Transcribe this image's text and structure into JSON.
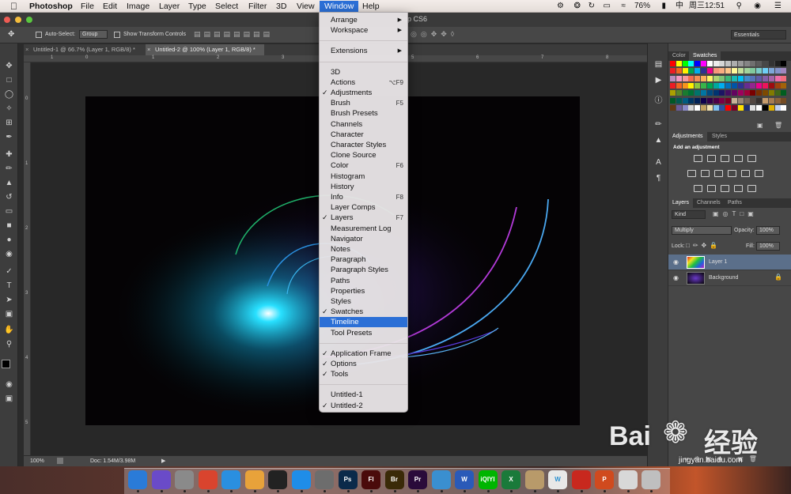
{
  "menubar": {
    "app_name": "Photoshop",
    "items": [
      "File",
      "Edit",
      "Image",
      "Layer",
      "Type",
      "Select",
      "Filter",
      "3D",
      "View",
      "Window",
      "Help"
    ],
    "status": {
      "battery": "76%",
      "clock": "周三12:51"
    }
  },
  "window_title_fragment": "hop CS6",
  "options_bar": {
    "auto_select_label": "Auto-Select:",
    "auto_select_value": "Group",
    "transform_label": "Show Transform Controls",
    "workspace": "Essentials"
  },
  "doc_tabs": [
    {
      "label": "Untitled-1 @ 66.7% (Layer 1, RGB/8) *"
    },
    {
      "label": "Untitled-2 @ 100% (Layer 1, RGB/8) *"
    }
  ],
  "ruler": {
    "h_ticks": [
      "1",
      "0",
      "1",
      "2",
      "3",
      "4",
      "5",
      "6",
      "7",
      "8"
    ],
    "v_ticks": [
      "0",
      "1",
      "2",
      "3",
      "4",
      "5"
    ]
  },
  "statusbar": {
    "zoom": "100%",
    "doc": "Doc: 1.54M/3.98M"
  },
  "window_menu": {
    "items": [
      {
        "label": "Arrange",
        "submenu": true
      },
      {
        "label": "Workspace",
        "submenu": true
      },
      {
        "sep": true
      },
      {
        "label": "Extensions",
        "submenu": true
      },
      {
        "sep": true
      },
      {
        "label": "3D"
      },
      {
        "label": "Actions",
        "shortcut": "⌥F9"
      },
      {
        "label": "Adjustments",
        "checked": true
      },
      {
        "label": "Brush",
        "shortcut": "F5"
      },
      {
        "label": "Brush Presets"
      },
      {
        "label": "Channels"
      },
      {
        "label": "Character"
      },
      {
        "label": "Character Styles"
      },
      {
        "label": "Clone Source"
      },
      {
        "label": "Color",
        "shortcut": "F6"
      },
      {
        "label": "Histogram"
      },
      {
        "label": "History"
      },
      {
        "label": "Info",
        "shortcut": "F8"
      },
      {
        "label": "Layer Comps"
      },
      {
        "label": "Layers",
        "checked": true,
        "shortcut": "F7"
      },
      {
        "label": "Measurement Log"
      },
      {
        "label": "Navigator"
      },
      {
        "label": "Notes"
      },
      {
        "label": "Paragraph"
      },
      {
        "label": "Paragraph Styles"
      },
      {
        "label": "Paths"
      },
      {
        "label": "Properties"
      },
      {
        "label": "Styles"
      },
      {
        "label": "Swatches",
        "checked": true
      },
      {
        "label": "Timeline",
        "highlight": true
      },
      {
        "label": "Tool Presets"
      },
      {
        "sep": true
      },
      {
        "label": "Application Frame",
        "checked": true
      },
      {
        "label": "Options",
        "checked": true
      },
      {
        "label": "Tools",
        "checked": true
      },
      {
        "sep": true
      },
      {
        "label": "Untitled-1"
      },
      {
        "label": "Untitled-2",
        "checked": true
      }
    ]
  },
  "panels": {
    "color_tabs": [
      "Color",
      "Swatches"
    ],
    "adjust_tabs": [
      "Adjustments",
      "Styles"
    ],
    "adjust_hint": "Add an adjustment",
    "layer_tabs": [
      "Layers",
      "Channels",
      "Paths"
    ],
    "kind_label": "Kind",
    "blend_mode": "Multiply",
    "opacity_label": "Opacity:",
    "opacity_value": "100%",
    "lock_label": "Lock:",
    "fill_label": "Fill:",
    "fill_value": "100%",
    "layers": [
      {
        "name": "Layer 1",
        "selected": true
      },
      {
        "name": "Background",
        "locked": true
      }
    ]
  },
  "dock": {
    "apps": [
      {
        "name": "finder-icon",
        "label": "",
        "color": "#2a7bd8"
      },
      {
        "name": "siri-icon",
        "label": "",
        "color": "#6a4bc8"
      },
      {
        "name": "launchpad-icon",
        "label": "",
        "color": "#8a8a8a"
      },
      {
        "name": "chrome-icon",
        "label": "",
        "color": "#d9442e"
      },
      {
        "name": "safari-icon",
        "label": "",
        "color": "#2a8fe0"
      },
      {
        "name": "photos-icon",
        "label": "",
        "color": "#e8a23a"
      },
      {
        "name": "qq-icon",
        "label": "",
        "color": "#222222"
      },
      {
        "name": "appstore-icon",
        "label": "",
        "color": "#1f8de8"
      },
      {
        "name": "preferences-icon",
        "label": "",
        "color": "#6d6d6d"
      },
      {
        "name": "photoshop-icon",
        "label": "Ps",
        "color": "#0b2a4a"
      },
      {
        "name": "flash-icon",
        "label": "Fl",
        "color": "#4a0b0b"
      },
      {
        "name": "bridge-icon",
        "label": "Br",
        "color": "#3a2a08"
      },
      {
        "name": "premiere-icon",
        "label": "Pr",
        "color": "#2a0b3a"
      },
      {
        "name": "quicktime-icon",
        "label": "",
        "color": "#3a8fd0"
      },
      {
        "name": "word-icon",
        "label": "W",
        "color": "#2a5ab8"
      },
      {
        "name": "iqiyi-icon",
        "label": "iQIYI",
        "color": "#00b500"
      },
      {
        "name": "excel-icon",
        "label": "X",
        "color": "#1a7a3a"
      },
      {
        "name": "archive-icon",
        "label": "",
        "color": "#b89a6a"
      },
      {
        "name": "wps-icon",
        "label": "W",
        "color": "#e8e8e8"
      },
      {
        "name": "flashplayer-icon",
        "label": "",
        "color": "#c8281e"
      },
      {
        "name": "powerpoint-icon",
        "label": "P",
        "color": "#d04a1e"
      },
      {
        "name": "mail-icon",
        "label": "",
        "color": "#d8d8d8"
      },
      {
        "name": "trash-icon",
        "label": "",
        "color": "#bfbfbf"
      }
    ]
  },
  "watermark": {
    "text": "Bai",
    "text2": "经验",
    "url": "jingyan.baidu.com"
  }
}
